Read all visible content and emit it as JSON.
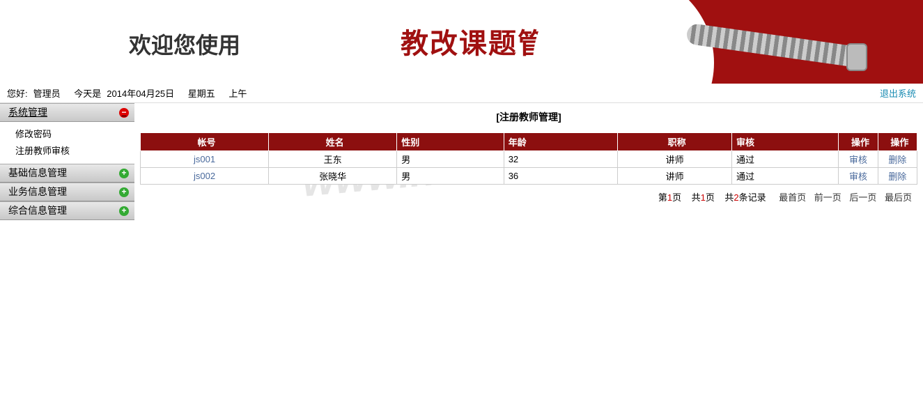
{
  "banner": {
    "welcome": "欢迎您使用",
    "title": "教改课题管理系统"
  },
  "status": {
    "greeting_prefix": "您好:",
    "user": "管理员",
    "today_prefix": "今天是",
    "date": "2014年04月25日",
    "weekday": "星期五",
    "ampm": "上午",
    "logout": "退出系统"
  },
  "sidebar": {
    "sections": [
      {
        "label": "系统管理",
        "expanded": true,
        "items": [
          "修改密码",
          "注册教师审核"
        ]
      },
      {
        "label": "基础信息管理",
        "expanded": false
      },
      {
        "label": "业务信息管理",
        "expanded": false
      },
      {
        "label": "综合信息管理",
        "expanded": false
      }
    ]
  },
  "page": {
    "title": "[注册教师管理]"
  },
  "table": {
    "headers": {
      "account": "帐号",
      "name": "姓名",
      "gender": "性别",
      "age": "年龄",
      "title": "职称",
      "audit": "审核",
      "op1": "操作",
      "op2": "操作"
    },
    "rows": [
      {
        "account": "js001",
        "name": "王东",
        "gender": "男",
        "age": "32",
        "title": "讲师",
        "audit": "通过",
        "op1": "审核",
        "op2": "删除"
      },
      {
        "account": "js002",
        "name": "张晓华",
        "gender": "男",
        "age": "36",
        "title": "讲师",
        "audit": "通过",
        "op1": "审核",
        "op2": "删除"
      }
    ]
  },
  "pagination": {
    "p1": "第",
    "cur_page": "1",
    "p2": "页",
    "p3": "共",
    "total_pages": "1",
    "p4": "页",
    "p5": "共",
    "total_records": "2",
    "p6": "条记录",
    "first": "最首页",
    "prev": "前一页",
    "next": "后一页",
    "last": "最后页"
  },
  "watermark": "www.httrd.com"
}
